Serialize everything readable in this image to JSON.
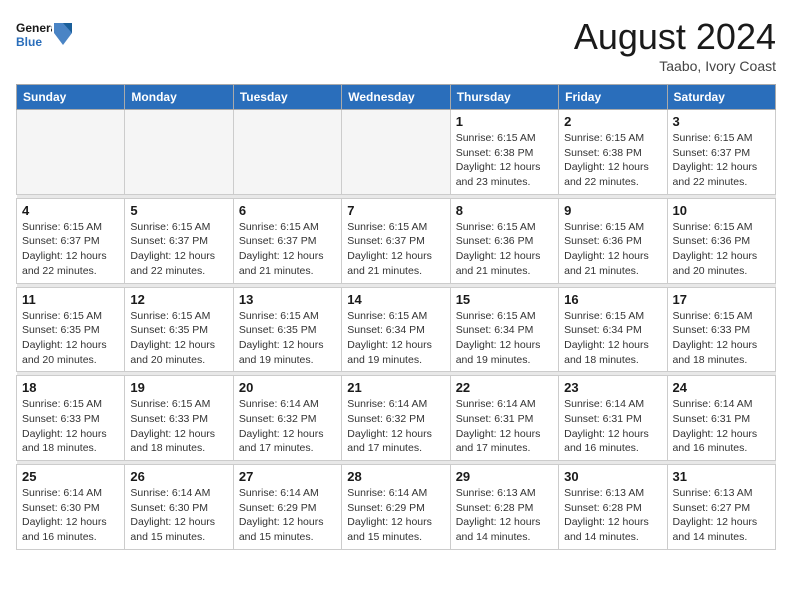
{
  "logo": {
    "line1": "General",
    "line2": "Blue"
  },
  "title": "August 2024",
  "subtitle": "Taabo, Ivory Coast",
  "weekdays": [
    "Sunday",
    "Monday",
    "Tuesday",
    "Wednesday",
    "Thursday",
    "Friday",
    "Saturday"
  ],
  "weeks": [
    [
      {
        "day": "",
        "info": ""
      },
      {
        "day": "",
        "info": ""
      },
      {
        "day": "",
        "info": ""
      },
      {
        "day": "",
        "info": ""
      },
      {
        "day": "1",
        "info": "Sunrise: 6:15 AM\nSunset: 6:38 PM\nDaylight: 12 hours\nand 23 minutes."
      },
      {
        "day": "2",
        "info": "Sunrise: 6:15 AM\nSunset: 6:38 PM\nDaylight: 12 hours\nand 22 minutes."
      },
      {
        "day": "3",
        "info": "Sunrise: 6:15 AM\nSunset: 6:37 PM\nDaylight: 12 hours\nand 22 minutes."
      }
    ],
    [
      {
        "day": "4",
        "info": "Sunrise: 6:15 AM\nSunset: 6:37 PM\nDaylight: 12 hours\nand 22 minutes."
      },
      {
        "day": "5",
        "info": "Sunrise: 6:15 AM\nSunset: 6:37 PM\nDaylight: 12 hours\nand 22 minutes."
      },
      {
        "day": "6",
        "info": "Sunrise: 6:15 AM\nSunset: 6:37 PM\nDaylight: 12 hours\nand 21 minutes."
      },
      {
        "day": "7",
        "info": "Sunrise: 6:15 AM\nSunset: 6:37 PM\nDaylight: 12 hours\nand 21 minutes."
      },
      {
        "day": "8",
        "info": "Sunrise: 6:15 AM\nSunset: 6:36 PM\nDaylight: 12 hours\nand 21 minutes."
      },
      {
        "day": "9",
        "info": "Sunrise: 6:15 AM\nSunset: 6:36 PM\nDaylight: 12 hours\nand 21 minutes."
      },
      {
        "day": "10",
        "info": "Sunrise: 6:15 AM\nSunset: 6:36 PM\nDaylight: 12 hours\nand 20 minutes."
      }
    ],
    [
      {
        "day": "11",
        "info": "Sunrise: 6:15 AM\nSunset: 6:35 PM\nDaylight: 12 hours\nand 20 minutes."
      },
      {
        "day": "12",
        "info": "Sunrise: 6:15 AM\nSunset: 6:35 PM\nDaylight: 12 hours\nand 20 minutes."
      },
      {
        "day": "13",
        "info": "Sunrise: 6:15 AM\nSunset: 6:35 PM\nDaylight: 12 hours\nand 19 minutes."
      },
      {
        "day": "14",
        "info": "Sunrise: 6:15 AM\nSunset: 6:34 PM\nDaylight: 12 hours\nand 19 minutes."
      },
      {
        "day": "15",
        "info": "Sunrise: 6:15 AM\nSunset: 6:34 PM\nDaylight: 12 hours\nand 19 minutes."
      },
      {
        "day": "16",
        "info": "Sunrise: 6:15 AM\nSunset: 6:34 PM\nDaylight: 12 hours\nand 18 minutes."
      },
      {
        "day": "17",
        "info": "Sunrise: 6:15 AM\nSunset: 6:33 PM\nDaylight: 12 hours\nand 18 minutes."
      }
    ],
    [
      {
        "day": "18",
        "info": "Sunrise: 6:15 AM\nSunset: 6:33 PM\nDaylight: 12 hours\nand 18 minutes."
      },
      {
        "day": "19",
        "info": "Sunrise: 6:15 AM\nSunset: 6:33 PM\nDaylight: 12 hours\nand 18 minutes."
      },
      {
        "day": "20",
        "info": "Sunrise: 6:14 AM\nSunset: 6:32 PM\nDaylight: 12 hours\nand 17 minutes."
      },
      {
        "day": "21",
        "info": "Sunrise: 6:14 AM\nSunset: 6:32 PM\nDaylight: 12 hours\nand 17 minutes."
      },
      {
        "day": "22",
        "info": "Sunrise: 6:14 AM\nSunset: 6:31 PM\nDaylight: 12 hours\nand 17 minutes."
      },
      {
        "day": "23",
        "info": "Sunrise: 6:14 AM\nSunset: 6:31 PM\nDaylight: 12 hours\nand 16 minutes."
      },
      {
        "day": "24",
        "info": "Sunrise: 6:14 AM\nSunset: 6:31 PM\nDaylight: 12 hours\nand 16 minutes."
      }
    ],
    [
      {
        "day": "25",
        "info": "Sunrise: 6:14 AM\nSunset: 6:30 PM\nDaylight: 12 hours\nand 16 minutes."
      },
      {
        "day": "26",
        "info": "Sunrise: 6:14 AM\nSunset: 6:30 PM\nDaylight: 12 hours\nand 15 minutes."
      },
      {
        "day": "27",
        "info": "Sunrise: 6:14 AM\nSunset: 6:29 PM\nDaylight: 12 hours\nand 15 minutes."
      },
      {
        "day": "28",
        "info": "Sunrise: 6:14 AM\nSunset: 6:29 PM\nDaylight: 12 hours\nand 15 minutes."
      },
      {
        "day": "29",
        "info": "Sunrise: 6:13 AM\nSunset: 6:28 PM\nDaylight: 12 hours\nand 14 minutes."
      },
      {
        "day": "30",
        "info": "Sunrise: 6:13 AM\nSunset: 6:28 PM\nDaylight: 12 hours\nand 14 minutes."
      },
      {
        "day": "31",
        "info": "Sunrise: 6:13 AM\nSunset: 6:27 PM\nDaylight: 12 hours\nand 14 minutes."
      }
    ]
  ]
}
